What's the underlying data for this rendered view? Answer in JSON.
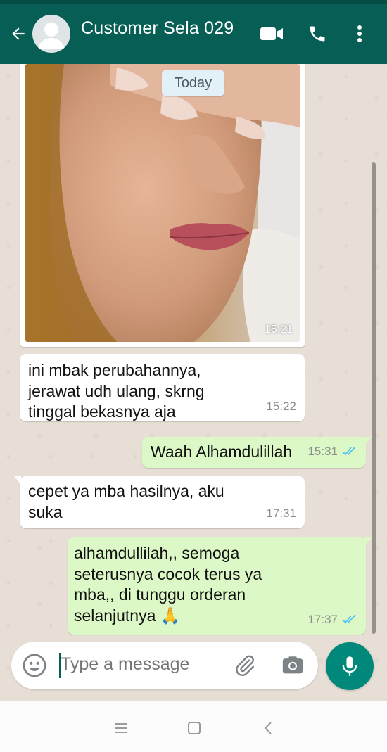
{
  "header": {
    "title": "Customer Sela 029",
    "icons": [
      "back-arrow-icon",
      "avatar",
      "video-call-icon",
      "voice-call-icon",
      "more-options-icon"
    ]
  },
  "chat": {
    "date_divider": "Today",
    "photo_message": {
      "time": "15:21"
    },
    "messages": [
      {
        "direction": "in",
        "text": "ini mbak perubahannya,\njerawat udh ulang, skrng\ntinggal bekasnya aja",
        "time": "15:22"
      },
      {
        "direction": "out",
        "text": "Waah Alhamdulillah",
        "time": "15:31",
        "status": "delivered"
      },
      {
        "direction": "in",
        "text": "cepet ya mba hasilnya, aku\nsuka",
        "time": "17:31"
      },
      {
        "direction": "out",
        "text": "alhamdullilah,, semoga\nseterusnya cocok terus ya\nmba,, di tunggu orderan\nselanjutnya 🙏",
        "time": "17:37",
        "status": "delivered"
      }
    ]
  },
  "composer": {
    "placeholder": "Type a message"
  },
  "colors": {
    "header": "#075e54",
    "outgoing_bubble": "#dcf8c6",
    "incoming_bubble": "#ffffff",
    "mic_button": "#00897b",
    "tick": "#4fc3f7"
  }
}
